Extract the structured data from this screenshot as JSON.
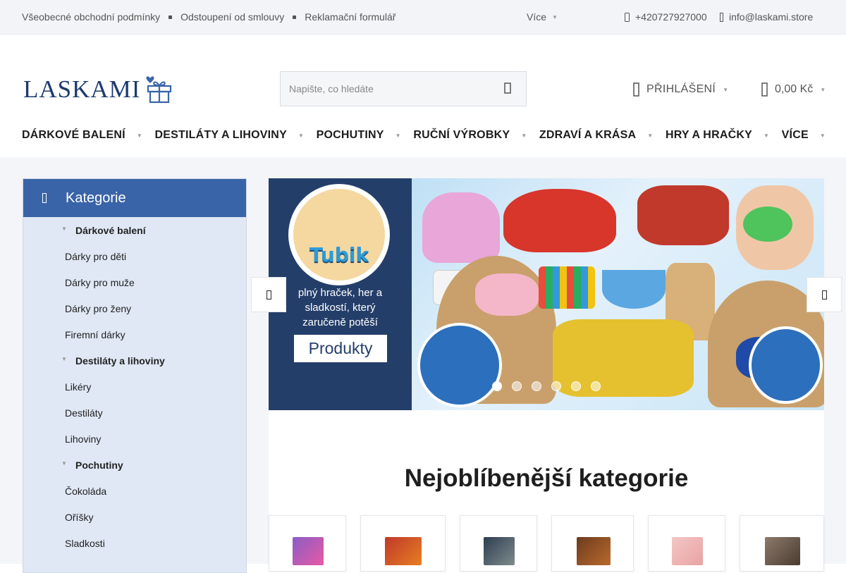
{
  "topbar": {
    "links": [
      "Všeobecné obchodní podmínky",
      "Odstoupení od smlouvy",
      "Reklamační formulář"
    ],
    "more": "Více",
    "phone": "+420727927000",
    "email": "info@laskami.store"
  },
  "header": {
    "logo_text": "LASKAMI",
    "search_placeholder": "Napište, co hledáte",
    "login": "PŘIHLÁŠENÍ",
    "cart_total": "0,00 Kč"
  },
  "nav": [
    "DÁRKOVÉ BALENÍ",
    "DESTILÁTY A LIHOVINY",
    "POCHUTINY",
    "RUČNÍ VÝROBKY",
    "ZDRAVÍ A KRÁSA",
    "HRY A HRAČKY",
    "VÍCE"
  ],
  "sidebar": {
    "title": "Kategorie",
    "items": [
      {
        "label": "Dárkové balení",
        "type": "parent"
      },
      {
        "label": "Dárky pro děti",
        "type": "child"
      },
      {
        "label": "Dárky pro muže",
        "type": "child"
      },
      {
        "label": "Dárky pro ženy",
        "type": "child"
      },
      {
        "label": "Firemní dárky",
        "type": "child"
      },
      {
        "label": "Destiláty a lihoviny",
        "type": "parent"
      },
      {
        "label": "Likéry",
        "type": "child"
      },
      {
        "label": "Destiláty",
        "type": "child"
      },
      {
        "label": "Lihoviny",
        "type": "child"
      },
      {
        "label": "Pochutiny",
        "type": "parent"
      },
      {
        "label": "Čokoláda",
        "type": "child"
      },
      {
        "label": "Oříšky",
        "type": "child"
      },
      {
        "label": "Sladkosti",
        "type": "child"
      }
    ]
  },
  "banner": {
    "brand": "Tubik",
    "tagline": "plný hraček, her a sladkostí, který zaručeně potěší",
    "button": "Produkty",
    "slides": 6,
    "active_slide": 1
  },
  "popular": {
    "title": "Nejoblíbenější kategorie"
  },
  "colors": {
    "accent": "#3a64a8",
    "sidebar_bg": "#dfe8f4",
    "banner_dark": "#243e6a"
  }
}
